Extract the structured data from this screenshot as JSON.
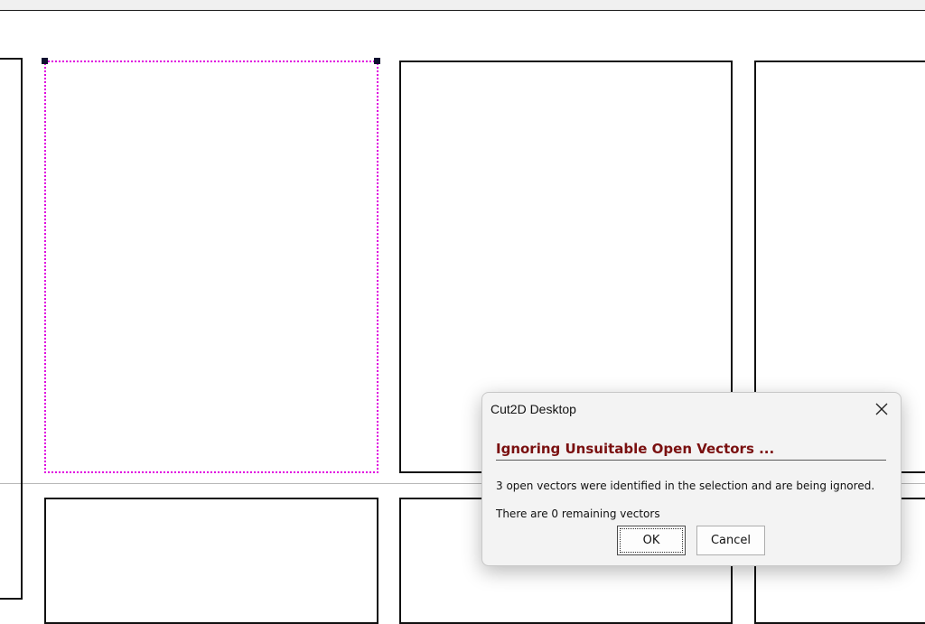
{
  "dialog": {
    "title": "Cut2D Desktop",
    "heading": "Ignoring Unsuitable Open Vectors ...",
    "message": "3 open vectors were identified in the selection and are being ignored.",
    "remaining": "There are 0 remaining vectors",
    "ok_label": "OK",
    "cancel_label": "Cancel"
  },
  "colors": {
    "selection": "#e000e0",
    "heading": "#7a1010",
    "vector": "#111111"
  },
  "icons": {
    "close": "close-icon"
  }
}
